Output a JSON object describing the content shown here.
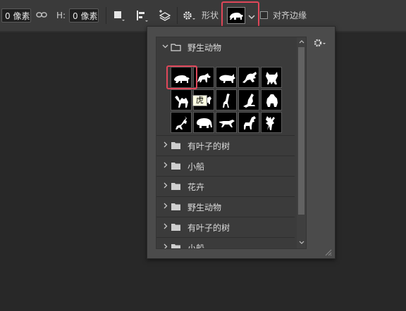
{
  "options_bar": {
    "width_value": "0 像素",
    "height_label": "H:",
    "height_value": "0 像素",
    "shape_label": "形状",
    "align_edges_label": "对齐边缘"
  },
  "shape_picker": {
    "groups": [
      {
        "name": "野生动物",
        "expanded": true
      },
      {
        "name": "有叶子的树",
        "expanded": false
      },
      {
        "name": "小船",
        "expanded": false
      },
      {
        "name": "花卉",
        "expanded": false
      },
      {
        "name": "野生动物",
        "expanded": false
      },
      {
        "name": "有叶子的树",
        "expanded": false
      },
      {
        "name": "小船",
        "expanded": false
      }
    ],
    "shape_icons": [
      "tiger-icon",
      "wolf-icon",
      "rhino-icon",
      "frog-icon",
      "wild-cat-icon",
      "camel-icon",
      "bull-icon",
      "giraffe-icon",
      "kangaroo-icon",
      "gorilla-icon",
      "deer-icon",
      "elephant-icon",
      "leopard-icon",
      "moose-icon",
      "stag-icon"
    ],
    "tooltip": "虎"
  },
  "colors": {
    "highlight": "#e0475a",
    "panel_bg": "#4b4b4b",
    "list_bg": "#3b3b3b",
    "toolbar_bg": "#3a3a3a",
    "workspace_bg": "#282828"
  }
}
